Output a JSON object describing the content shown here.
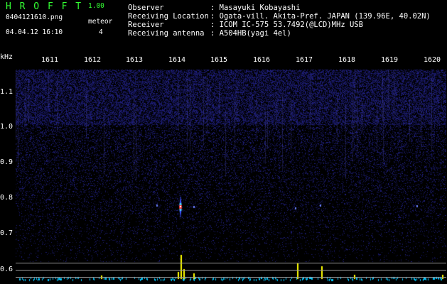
{
  "app": {
    "name": "H R O F F T",
    "version": "1.00"
  },
  "file": {
    "name": "0404121610.png",
    "datetime": "04.04.12 16:10"
  },
  "meteor": {
    "label": "meteor",
    "count": "4"
  },
  "info": [
    {
      "label": "Observer",
      "value": ": Masayuki Kobayashi"
    },
    {
      "label": "Receiving Location",
      "value": ": Ogata-vill. Akita-Pref. JAPAN (139.96E, 40.02N)"
    },
    {
      "label": "Receiver",
      "value": ": ICOM IC-575 53.7492(@LCD)MHz USB"
    },
    {
      "label": "Receiving antenna",
      "value": ": A504HB(yagi 4el)"
    }
  ],
  "axes": {
    "y_unit": "kHz",
    "y_ticks": [
      "1.1",
      "1.0",
      "0.9",
      "0.8",
      "0.7",
      "0.6"
    ],
    "x_ticks": [
      "1611",
      "1612",
      "1613",
      "1614",
      "1615",
      "1616",
      "1617",
      "1618",
      "1619",
      "1620"
    ]
  },
  "colors": {
    "background": "#000000",
    "header_green": "#33ff33",
    "noise": "#1a1a6e",
    "meteor_core": "#ff3030",
    "power_trace": "#ffff00",
    "baseline": "#00c8ff"
  }
}
